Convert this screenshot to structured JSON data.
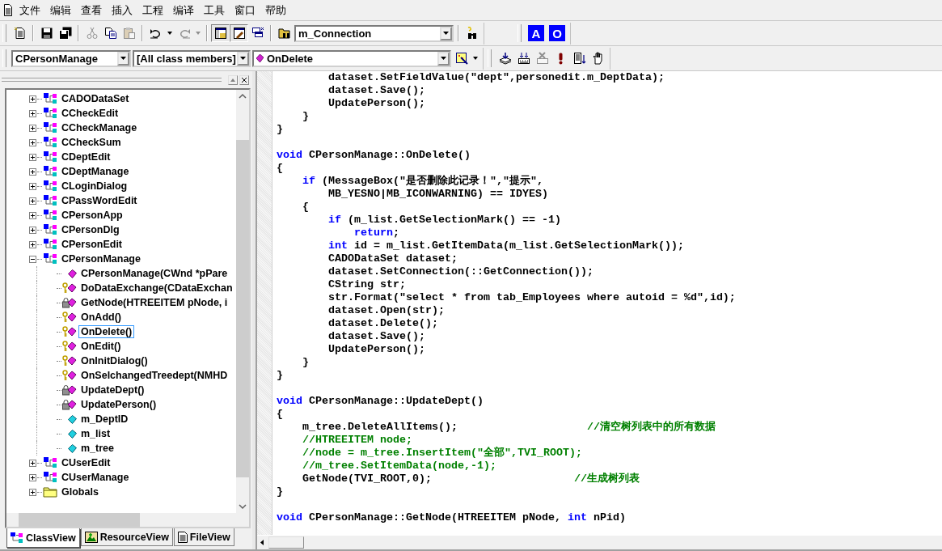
{
  "menu_bar": {
    "items": [
      "文件",
      "编辑",
      "查看",
      "插入",
      "工程",
      "编译",
      "工具",
      "窗口",
      "帮助"
    ]
  },
  "standard_toolbar": {
    "groups": [
      [
        {
          "kind": "new",
          "disabled": false,
          "pressed": false
        }
      ],
      [
        {
          "kind": "save",
          "disabled": false,
          "pressed": false
        },
        {
          "kind": "saveall",
          "disabled": false,
          "pressed": false
        }
      ],
      [
        {
          "kind": "cut",
          "disabled": true,
          "pressed": false
        },
        {
          "kind": "copy",
          "disabled": false,
          "pressed": false
        },
        {
          "kind": "paste",
          "disabled": true,
          "pressed": false
        }
      ],
      [
        {
          "kind": "undo",
          "disabled": false,
          "pressed": false
        },
        {
          "kind": "dropdown",
          "disabled": false,
          "pressed": false
        },
        {
          "kind": "redo",
          "disabled": true,
          "pressed": false
        },
        {
          "kind": "dropdown",
          "disabled": true,
          "pressed": false
        }
      ],
      [
        {
          "kind": "workspace",
          "disabled": false,
          "pressed": true
        },
        {
          "kind": "output",
          "disabled": false,
          "pressed": true
        },
        {
          "kind": "windows",
          "disabled": false,
          "pressed": false
        }
      ],
      [
        {
          "kind": "findfiles",
          "disabled": false,
          "pressed": false
        },
        {
          "kind": "combo",
          "value": "m_Connection"
        }
      ],
      [
        {
          "kind": "find",
          "disabled": false,
          "pressed": false
        }
      ]
    ]
  },
  "letter_toolbar": {
    "groups": [
      [
        {
          "kind": "letter",
          "text": "A"
        },
        {
          "kind": "letter",
          "text": "O"
        }
      ]
    ]
  },
  "wizard_bar": {
    "groups": [
      [
        {
          "kind": "combo",
          "value": "CPersonManage"
        },
        {
          "kind": "combo",
          "value": "[All class members]"
        },
        {
          "kind": "membercombo",
          "value": "OnDelete"
        },
        {
          "kind": "wizard",
          "disabled": false,
          "pressed": false
        },
        {
          "kind": "dropdown",
          "disabled": false,
          "pressed": false
        }
      ]
    ]
  },
  "build_toolbar": {
    "groups": [
      [
        {
          "kind": "compile",
          "disabled": false,
          "pressed": false
        },
        {
          "kind": "build",
          "disabled": false,
          "pressed": false
        },
        {
          "kind": "stop",
          "disabled": true,
          "pressed": false
        },
        {
          "kind": "execute",
          "disabled": false,
          "pressed": false
        },
        {
          "kind": "go",
          "disabled": false,
          "pressed": false
        },
        {
          "kind": "breakpoint",
          "disabled": false,
          "pressed": false
        }
      ]
    ]
  },
  "tree": {
    "items": [
      {
        "label": "CADODataSet",
        "kind": "class",
        "expanded": false,
        "selected": false
      },
      {
        "label": "CCheckEdit",
        "kind": "class",
        "expanded": false,
        "selected": false
      },
      {
        "label": "CCheckManage",
        "kind": "class",
        "expanded": false,
        "selected": false
      },
      {
        "label": "CCheckSum",
        "kind": "class",
        "expanded": false,
        "selected": false
      },
      {
        "label": "CDeptEdit",
        "kind": "class",
        "expanded": false,
        "selected": false
      },
      {
        "label": "CDeptManage",
        "kind": "class",
        "expanded": false,
        "selected": false
      },
      {
        "label": "CLoginDialog",
        "kind": "class",
        "expanded": false,
        "selected": false
      },
      {
        "label": "CPassWordEdit",
        "kind": "class",
        "expanded": false,
        "selected": false
      },
      {
        "label": "CPersonApp",
        "kind": "class",
        "expanded": false,
        "selected": false
      },
      {
        "label": "CPersonDlg",
        "kind": "class",
        "expanded": false,
        "selected": false
      },
      {
        "label": "CPersonEdit",
        "kind": "class",
        "expanded": false,
        "selected": false
      },
      {
        "label": "CPersonManage",
        "kind": "class",
        "expanded": true,
        "selected": false,
        "children": [
          {
            "label": "CPersonManage(CWnd *pPare",
            "kind": "function",
            "selected": false
          },
          {
            "label": "DoDataExchange(CDataExchan",
            "kind": "protected",
            "selected": false
          },
          {
            "label": "GetNode(HTREEITEM pNode, i",
            "kind": "private",
            "selected": false
          },
          {
            "label": "OnAdd()",
            "kind": "protected",
            "selected": false
          },
          {
            "label": "OnDelete()",
            "kind": "protected",
            "selected": true
          },
          {
            "label": "OnEdit()",
            "kind": "protected",
            "selected": false
          },
          {
            "label": "OnInitDialog()",
            "kind": "protected",
            "selected": false
          },
          {
            "label": "OnSelchangedTreedept(NMHD",
            "kind": "protected",
            "selected": false
          },
          {
            "label": "UpdateDept()",
            "kind": "private",
            "selected": false
          },
          {
            "label": "UpdatePerson()",
            "kind": "private",
            "selected": false
          },
          {
            "label": "m_DeptID",
            "kind": "variable",
            "selected": false
          },
          {
            "label": "m_list",
            "kind": "variable",
            "selected": false
          },
          {
            "label": "m_tree",
            "kind": "variable",
            "selected": false
          }
        ]
      },
      {
        "label": "CUserEdit",
        "kind": "class",
        "expanded": false,
        "selected": false
      },
      {
        "label": "CUserManage",
        "kind": "class",
        "expanded": false,
        "selected": false
      },
      {
        "label": "Globals",
        "kind": "folder",
        "expanded": false,
        "selected": false
      }
    ]
  },
  "workspace_tabs": [
    {
      "label": "ClassView",
      "kind": "classes",
      "selected": true
    },
    {
      "label": "ResourceView",
      "kind": "resources",
      "selected": false
    },
    {
      "label": "FileView",
      "kind": "files",
      "selected": false
    }
  ],
  "code_lines": [
    {
      "kind": "code",
      "tokens": [
        {
          "kind": "plain",
          "text": "        dataset.SetFieldValue(\"dept\",personedit.m_DeptData);"
        }
      ]
    },
    {
      "kind": "code",
      "tokens": [
        {
          "kind": "plain",
          "text": "        dataset.Save();"
        }
      ]
    },
    {
      "kind": "code",
      "tokens": [
        {
          "kind": "plain",
          "text": "        UpdatePerson();"
        }
      ]
    },
    {
      "kind": "code",
      "tokens": [
        {
          "kind": "plain",
          "text": "    }"
        }
      ]
    },
    {
      "kind": "code",
      "tokens": [
        {
          "kind": "plain",
          "text": "}"
        }
      ]
    },
    {
      "kind": "blank"
    },
    {
      "kind": "code",
      "tokens": [
        {
          "kind": "keyword",
          "text": "void"
        },
        {
          "kind": "plain",
          "text": " CPersonManage::OnDelete()"
        }
      ]
    },
    {
      "kind": "code",
      "tokens": [
        {
          "kind": "plain",
          "text": "{"
        }
      ]
    },
    {
      "kind": "code",
      "tokens": [
        {
          "kind": "keyword",
          "text": "    if"
        },
        {
          "kind": "plain",
          "text": " (MessageBox(\"是否删除此记录！\",\"提示\","
        }
      ]
    },
    {
      "kind": "code",
      "tokens": [
        {
          "kind": "plain",
          "text": "        MB_YESNO|MB_ICONWARNING) == IDYES)"
        }
      ]
    },
    {
      "kind": "code",
      "tokens": [
        {
          "kind": "plain",
          "text": "    {"
        }
      ]
    },
    {
      "kind": "code",
      "tokens": [
        {
          "kind": "keyword",
          "text": "        if"
        },
        {
          "kind": "plain",
          "text": " (m_list.GetSelectionMark() == -1)"
        }
      ]
    },
    {
      "kind": "code",
      "tokens": [
        {
          "kind": "keyword",
          "text": "            return"
        },
        {
          "kind": "plain",
          "text": ";"
        }
      ]
    },
    {
      "kind": "code",
      "tokens": [
        {
          "kind": "keyword",
          "text": "        int"
        },
        {
          "kind": "plain",
          "text": " id = m_list.GetItemData(m_list.GetSelectionMark());"
        }
      ]
    },
    {
      "kind": "code",
      "tokens": [
        {
          "kind": "plain",
          "text": "        CADODataSet dataset;"
        }
      ]
    },
    {
      "kind": "code",
      "tokens": [
        {
          "kind": "plain",
          "text": "        dataset.SetConnection(::GetConnection());"
        }
      ]
    },
    {
      "kind": "code",
      "tokens": [
        {
          "kind": "plain",
          "text": "        CString str;"
        }
      ]
    },
    {
      "kind": "code",
      "tokens": [
        {
          "kind": "plain",
          "text": "        str.Format(\"select * from tab_Employees where autoid = %d\",id);"
        }
      ]
    },
    {
      "kind": "code",
      "tokens": [
        {
          "kind": "plain",
          "text": "        dataset.Open(str);"
        }
      ]
    },
    {
      "kind": "code",
      "tokens": [
        {
          "kind": "plain",
          "text": "        dataset.Delete();"
        }
      ]
    },
    {
      "kind": "code",
      "tokens": [
        {
          "kind": "plain",
          "text": "        dataset.Save();"
        }
      ]
    },
    {
      "kind": "code",
      "tokens": [
        {
          "kind": "plain",
          "text": "        UpdatePerson();"
        }
      ]
    },
    {
      "kind": "code",
      "tokens": [
        {
          "kind": "plain",
          "text": "    }"
        }
      ]
    },
    {
      "kind": "code",
      "tokens": [
        {
          "kind": "plain",
          "text": "}"
        }
      ]
    },
    {
      "kind": "blank"
    },
    {
      "kind": "code",
      "tokens": [
        {
          "kind": "keyword",
          "text": "void"
        },
        {
          "kind": "plain",
          "text": " CPersonManage::UpdateDept()"
        }
      ]
    },
    {
      "kind": "code",
      "tokens": [
        {
          "kind": "plain",
          "text": "{"
        }
      ]
    },
    {
      "kind": "code",
      "tokens": [
        {
          "kind": "plain",
          "text": "    m_tree.DeleteAllItems();                    "
        },
        {
          "kind": "comment",
          "text": "//清空树列表中的所有数据"
        }
      ]
    },
    {
      "kind": "code",
      "tokens": [
        {
          "kind": "comment",
          "text": "    //HTREEITEM node;"
        }
      ]
    },
    {
      "kind": "code",
      "tokens": [
        {
          "kind": "comment",
          "text": "    //node = m_tree.InsertItem(\"全部\",TVI_ROOT);"
        }
      ]
    },
    {
      "kind": "code",
      "tokens": [
        {
          "kind": "comment",
          "text": "    //m_tree.SetItemData(node,-1);"
        }
      ]
    },
    {
      "kind": "code",
      "tokens": [
        {
          "kind": "plain",
          "text": "    GetNode(TVI_ROOT,0);                      "
        },
        {
          "kind": "comment",
          "text": "//生成树列表"
        }
      ]
    },
    {
      "kind": "code",
      "tokens": [
        {
          "kind": "plain",
          "text": "}"
        }
      ]
    },
    {
      "kind": "blank"
    },
    {
      "kind": "code",
      "tokens": [
        {
          "kind": "keyword",
          "text": "void"
        },
        {
          "kind": "plain",
          "text": " CPersonManage::GetNode(HTREEITEM pNode, "
        },
        {
          "kind": "keyword",
          "text": "int"
        },
        {
          "kind": "plain",
          "text": " nPid)"
        }
      ]
    }
  ]
}
